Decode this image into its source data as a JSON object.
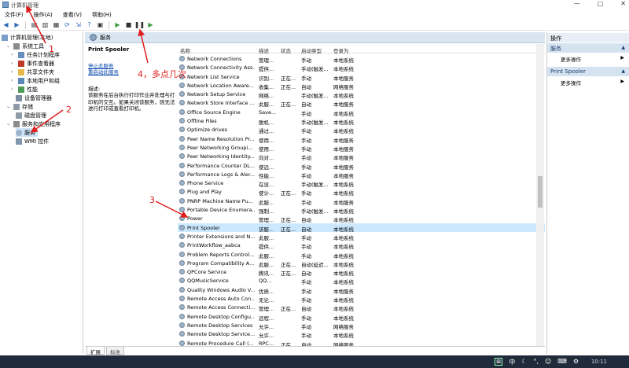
{
  "window": {
    "title": "计算机管理",
    "min": "—",
    "max": "▢",
    "close": "✕"
  },
  "menu": [
    "文件(F)",
    "操作(A)",
    "查看(V)",
    "帮助(H)"
  ],
  "tree": [
    {
      "label": "计算机管理(本地)",
      "depth": 0,
      "expand": ""
    },
    {
      "label": "系统工具",
      "depth": 1,
      "expand": "⌄"
    },
    {
      "label": "任务计划程序",
      "depth": 2,
      "expand": "›"
    },
    {
      "label": "事件查看器",
      "depth": 2,
      "expand": "›"
    },
    {
      "label": "共享文件夹",
      "depth": 2,
      "expand": "›"
    },
    {
      "label": "本地用户和组",
      "depth": 2,
      "expand": "›"
    },
    {
      "label": "性能",
      "depth": 2,
      "expand": "›"
    },
    {
      "label": "设备管理器",
      "depth": 2,
      "expand": ""
    },
    {
      "label": "存储",
      "depth": 1,
      "expand": "⌄"
    },
    {
      "label": "磁盘管理",
      "depth": 2,
      "expand": ""
    },
    {
      "label": "服务和应用程序",
      "depth": 1,
      "expand": "⌄"
    },
    {
      "label": "服务",
      "depth": 2,
      "expand": "",
      "selected": true
    },
    {
      "label": "WMI 控件",
      "depth": 2,
      "expand": ""
    }
  ],
  "center": {
    "header": "服务",
    "selected_service": "Print Spooler",
    "stop_link": "停止此服务",
    "restart_link": "重启动此服务",
    "desc_label": "描述:",
    "desc_text": "该服务在后台执行打印作业并处理与打印机的交互。如果关闭该服务，则无法进行打印或查看打印机。"
  },
  "columns": {
    "name": "名称",
    "desc": "描述",
    "status": "状态",
    "startup": "启动类型",
    "logon": "登录为"
  },
  "services": [
    {
      "name": "Network Connections",
      "desc": "管理...",
      "status": "",
      "startup": "手动",
      "logon": "本地系统"
    },
    {
      "name": "Network Connectivity Ass...",
      "desc": "提供...",
      "status": "",
      "startup": "手动(触发...",
      "logon": "本地系统"
    },
    {
      "name": "Network List Service",
      "desc": "识别...",
      "status": "正在...",
      "startup": "手动",
      "logon": "本地服务"
    },
    {
      "name": "Network Location Aware...",
      "desc": "收集...",
      "status": "正在...",
      "startup": "自动",
      "logon": "网络服务"
    },
    {
      "name": "Network Setup Service",
      "desc": "网络...",
      "status": "",
      "startup": "手动(触发...",
      "logon": "本地系统"
    },
    {
      "name": "Network Store Interface ...",
      "desc": "此服...",
      "status": "正在...",
      "startup": "自动",
      "logon": "本地服务"
    },
    {
      "name": "Office  Source Engine",
      "desc": "Save...",
      "status": "",
      "startup": "手动",
      "logon": "本地系统"
    },
    {
      "name": "Offline Files",
      "desc": "脱机...",
      "status": "",
      "startup": "手动(触发...",
      "logon": "本地系统"
    },
    {
      "name": "Optimize drives",
      "desc": "通过...",
      "status": "",
      "startup": "手动",
      "logon": "本地系统"
    },
    {
      "name": "Peer Name Resolution Pr...",
      "desc": "使用...",
      "status": "",
      "startup": "手动",
      "logon": "本地服务"
    },
    {
      "name": "Peer Networking Groupi...",
      "desc": "使用...",
      "status": "",
      "startup": "手动",
      "logon": "本地服务"
    },
    {
      "name": "Peer Networking Identity...",
      "desc": "向对...",
      "status": "",
      "startup": "手动",
      "logon": "本地服务"
    },
    {
      "name": "Performance Counter DL...",
      "desc": "使远...",
      "status": "",
      "startup": "手动",
      "logon": "本地服务"
    },
    {
      "name": "Performance Logs & Aler...",
      "desc": "性能...",
      "status": "",
      "startup": "手动",
      "logon": "本地服务"
    },
    {
      "name": "Phone Service",
      "desc": "在设...",
      "status": "",
      "startup": "手动(触发...",
      "logon": "本地系统"
    },
    {
      "name": "Plug and Play",
      "desc": "使计...",
      "status": "正在...",
      "startup": "手动",
      "logon": "本地系统"
    },
    {
      "name": "PNRP Machine Name Pu...",
      "desc": "此服...",
      "status": "",
      "startup": "手动",
      "logon": "本地服务"
    },
    {
      "name": "Portable Device Enumera...",
      "desc": "强制...",
      "status": "",
      "startup": "手动(触发...",
      "logon": "本地系统"
    },
    {
      "name": "Power",
      "desc": "管理...",
      "status": "正在...",
      "startup": "自动",
      "logon": "本地系统"
    },
    {
      "name": "Print Spooler",
      "desc": "该服...",
      "status": "正在...",
      "startup": "自动",
      "logon": "本地系统",
      "selected": true
    },
    {
      "name": "Printer Extensions and N...",
      "desc": "此服...",
      "status": "",
      "startup": "手动",
      "logon": "本地系统"
    },
    {
      "name": "PrintWorkflow_aabca",
      "desc": "提供...",
      "status": "",
      "startup": "手动",
      "logon": "本地系统"
    },
    {
      "name": "Problem Reports Control...",
      "desc": "此服...",
      "status": "",
      "startup": "手动",
      "logon": "本地系统"
    },
    {
      "name": "Program Compatibility A...",
      "desc": "此服...",
      "status": "正在...",
      "startup": "自动(延迟...",
      "logon": "本地系统"
    },
    {
      "name": "QPCore Service",
      "desc": "腾讯...",
      "status": "正在...",
      "startup": "自动",
      "logon": "本地系统"
    },
    {
      "name": "QQMusicService",
      "desc": "QQ...",
      "status": "",
      "startup": "手动",
      "logon": "本地系统"
    },
    {
      "name": "Quality Windows Audio V...",
      "desc": "优质...",
      "status": "",
      "startup": "手动",
      "logon": "本地服务"
    },
    {
      "name": "Remote Access Auto Con...",
      "desc": "无论...",
      "status": "",
      "startup": "手动",
      "logon": "本地系统"
    },
    {
      "name": "Remote Access Connecti...",
      "desc": "管理...",
      "status": "正在...",
      "startup": "自动",
      "logon": "本地系统"
    },
    {
      "name": "Remote Desktop Configu...",
      "desc": "远程...",
      "status": "",
      "startup": "手动",
      "logon": "本地系统"
    },
    {
      "name": "Remote Desktop Services",
      "desc": "允许...",
      "status": "",
      "startup": "手动",
      "logon": "网络服务"
    },
    {
      "name": "Remote Desktop Service...",
      "desc": "允许...",
      "status": "",
      "startup": "手动",
      "logon": "本地系统"
    },
    {
      "name": "Remote Procedure Call (...",
      "desc": "RPC...",
      "status": "正在...",
      "startup": "自动",
      "logon": "网络服务"
    }
  ],
  "tabs": [
    "扩展",
    "标准"
  ],
  "actions": {
    "title": "操作",
    "group1": "服务",
    "group1_more": "更多操作",
    "group2": "Print Spooler",
    "group2_more": "更多操作"
  },
  "taskbar": {
    "ime": "中",
    "punct": "°,",
    "time": "10:11"
  },
  "annotations": {
    "a1": "1",
    "a2": "2",
    "a3": "3",
    "a4": "4，多点几次"
  }
}
